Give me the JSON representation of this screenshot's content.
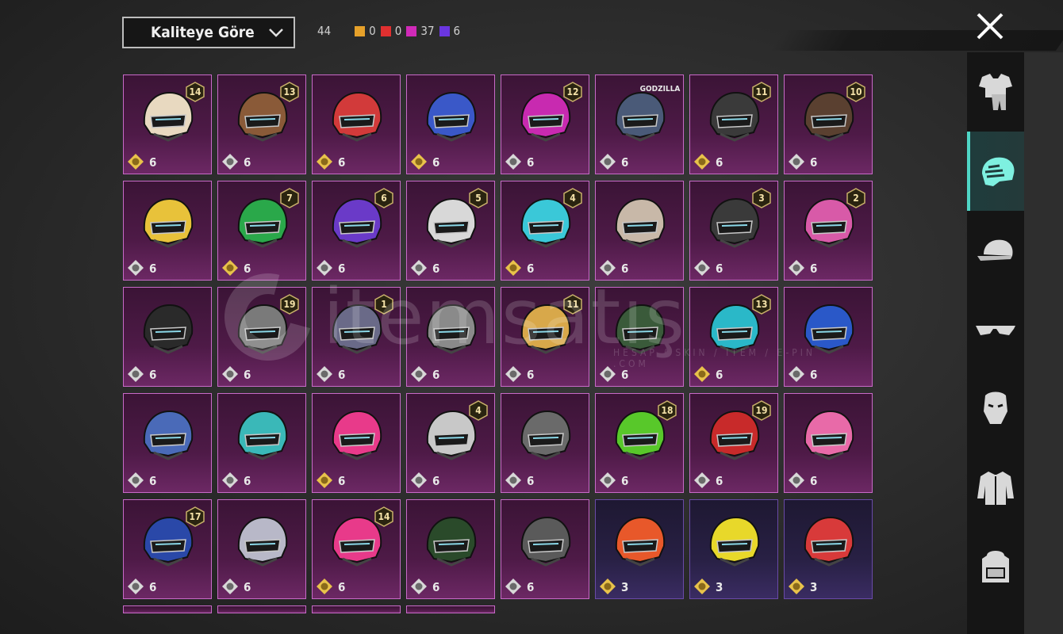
{
  "sort": {
    "label": "Kaliteye Göre"
  },
  "counts": {
    "total": "44",
    "items": [
      {
        "color": "#e6a12a",
        "value": "0"
      },
      {
        "color": "#e03030",
        "value": "0"
      },
      {
        "color": "#d02ab8",
        "value": "37"
      },
      {
        "color": "#6a36e0",
        "value": "6"
      }
    ]
  },
  "watermark": {
    "brand": "itemsatış",
    "sub": "HESAP / SKIN / ITEM / E-PIN .COM"
  },
  "categories": [
    {
      "name": "outfit-icon",
      "active": false
    },
    {
      "name": "helmet-icon",
      "active": true
    },
    {
      "name": "cap-icon",
      "active": false
    },
    {
      "name": "glasses-icon",
      "active": false
    },
    {
      "name": "mask-icon",
      "active": false
    },
    {
      "name": "jacket-icon",
      "active": false
    },
    {
      "name": "backpack-icon",
      "active": false
    }
  ],
  "items": [
    {
      "badge": "14",
      "count": "6",
      "rarity": "legend",
      "currency": "gold",
      "color": "#e8d9c0"
    },
    {
      "badge": "13",
      "count": "6",
      "rarity": "legend",
      "currency": "silver",
      "color": "#8a5a38"
    },
    {
      "badge": "",
      "count": "6",
      "rarity": "legend",
      "currency": "gold",
      "color": "#d23a3a"
    },
    {
      "badge": "",
      "count": "6",
      "rarity": "legend",
      "currency": "gold",
      "color": "#3a58c8"
    },
    {
      "badge": "12",
      "count": "6",
      "rarity": "legend",
      "currency": "silver",
      "color": "#c82ab0"
    },
    {
      "badge": "GODZILLA",
      "count": "6",
      "rarity": "legend",
      "currency": "silver",
      "color": "#4a5a78"
    },
    {
      "badge": "11",
      "count": "6",
      "rarity": "legend",
      "currency": "gold",
      "color": "#3a3a3a"
    },
    {
      "badge": "10",
      "count": "6",
      "rarity": "legend",
      "currency": "silver",
      "color": "#5a4030"
    },
    {
      "badge": "",
      "count": "6",
      "rarity": "legend",
      "currency": "silver",
      "color": "#e8c23a"
    },
    {
      "badge": "7",
      "count": "6",
      "rarity": "legend",
      "currency": "gold",
      "color": "#2aa84a"
    },
    {
      "badge": "6",
      "count": "6",
      "rarity": "legend",
      "currency": "silver",
      "color": "#6a3ac8"
    },
    {
      "badge": "5",
      "count": "6",
      "rarity": "legend",
      "currency": "silver",
      "color": "#d8d8d8"
    },
    {
      "badge": "4",
      "count": "6",
      "rarity": "legend",
      "currency": "gold",
      "color": "#3ac8d8"
    },
    {
      "badge": "",
      "count": "6",
      "rarity": "legend",
      "currency": "silver",
      "color": "#c8b8a8"
    },
    {
      "badge": "3",
      "count": "6",
      "rarity": "legend",
      "currency": "silver",
      "color": "#3a3a3a"
    },
    {
      "badge": "2",
      "count": "6",
      "rarity": "legend",
      "currency": "silver",
      "color": "#d85aa8"
    },
    {
      "badge": "",
      "count": "6",
      "rarity": "legend",
      "currency": "silver",
      "color": "#2a2a2a"
    },
    {
      "badge": "19",
      "count": "6",
      "rarity": "legend",
      "currency": "silver",
      "color": "#7a7a7a"
    },
    {
      "badge": "1",
      "count": "6",
      "rarity": "legend",
      "currency": "silver",
      "color": "#6a6a88"
    },
    {
      "badge": "",
      "count": "6",
      "rarity": "legend",
      "currency": "silver",
      "color": "#8a8a8a"
    },
    {
      "badge": "11",
      "count": "6",
      "rarity": "legend",
      "currency": "silver",
      "color": "#d8a84a"
    },
    {
      "badge": "",
      "count": "6",
      "rarity": "legend",
      "currency": "silver",
      "color": "#3a5a3a"
    },
    {
      "badge": "13",
      "count": "6",
      "rarity": "legend",
      "currency": "gold",
      "color": "#2ab8c8"
    },
    {
      "badge": "",
      "count": "6",
      "rarity": "legend",
      "currency": "silver",
      "color": "#2a58c8"
    },
    {
      "badge": "",
      "count": "6",
      "rarity": "legend",
      "currency": "silver",
      "color": "#4a6ab8"
    },
    {
      "badge": "",
      "count": "6",
      "rarity": "legend",
      "currency": "silver",
      "color": "#3ab8b8"
    },
    {
      "badge": "",
      "count": "6",
      "rarity": "legend",
      "currency": "gold",
      "color": "#e83a8a"
    },
    {
      "badge": "4",
      "count": "6",
      "rarity": "legend",
      "currency": "silver",
      "color": "#c8c8c8"
    },
    {
      "badge": "",
      "count": "6",
      "rarity": "legend",
      "currency": "silver",
      "color": "#6a6a6a"
    },
    {
      "badge": "18",
      "count": "6",
      "rarity": "legend",
      "currency": "silver",
      "color": "#58c82a"
    },
    {
      "badge": "19",
      "count": "6",
      "rarity": "legend",
      "currency": "silver",
      "color": "#c82a2a"
    },
    {
      "badge": "",
      "count": "6",
      "rarity": "legend",
      "currency": "silver",
      "color": "#e86aa8"
    },
    {
      "badge": "17",
      "count": "6",
      "rarity": "legend",
      "currency": "silver",
      "color": "#2a48a8"
    },
    {
      "badge": "",
      "count": "6",
      "rarity": "legend",
      "currency": "silver",
      "color": "#b8b8c8"
    },
    {
      "badge": "14",
      "count": "6",
      "rarity": "legend",
      "currency": "gold",
      "color": "#e83a8a"
    },
    {
      "badge": "",
      "count": "6",
      "rarity": "legend",
      "currency": "silver",
      "color": "#2a4a2a"
    },
    {
      "badge": "",
      "count": "6",
      "rarity": "legend",
      "currency": "silver",
      "color": "#5a5a5a"
    },
    {
      "badge": "",
      "count": "3",
      "rarity": "purple",
      "currency": "gold",
      "color": "#e8582a"
    },
    {
      "badge": "",
      "count": "3",
      "rarity": "purple",
      "currency": "gold",
      "color": "#e8d82a"
    },
    {
      "badge": "",
      "count": "3",
      "rarity": "purple",
      "currency": "gold",
      "color": "#d83a3a"
    }
  ]
}
